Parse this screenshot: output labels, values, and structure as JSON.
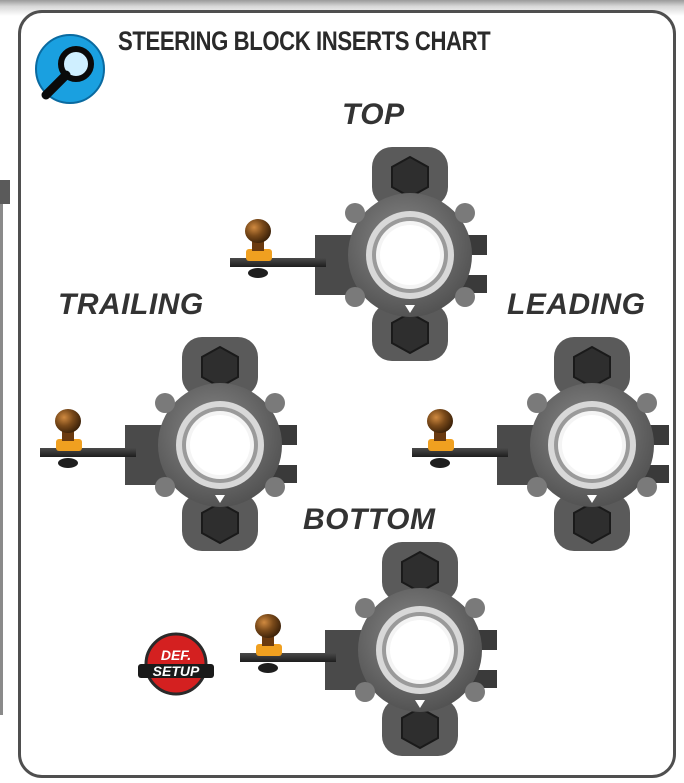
{
  "title": "STEERING BLOCK INSERTS CHART",
  "positions": {
    "top": "TOP",
    "trailing": "TRAILING",
    "leading": "LEADING",
    "bottom": "BOTTOM"
  },
  "badge": {
    "line1": "DEF.",
    "line2": "SETUP"
  },
  "icons": {
    "header": "magnifier-icon",
    "badge": "default-setup-badge"
  },
  "colors": {
    "border": "#4f4f4f",
    "block": "#5a5a5a",
    "ring": "#e6e6e6",
    "ball": "#7a4a1a",
    "orange": "#f0a020",
    "badge_red": "#d42020",
    "icon_blue": "#1aa0e0"
  }
}
